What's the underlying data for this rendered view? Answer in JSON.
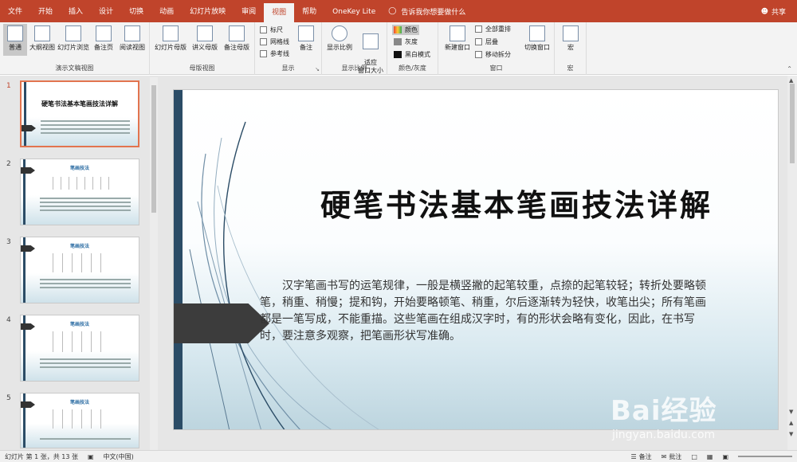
{
  "tabs": [
    "文件",
    "开始",
    "插入",
    "设计",
    "切换",
    "动画",
    "幻灯片放映",
    "审阅",
    "视图",
    "帮助",
    "OneKey Lite"
  ],
  "active_tab": "视图",
  "tellme": "告诉我你想要做什么",
  "share": "共享",
  "ribbon": {
    "presentation_views": {
      "title": "演示文稿视图",
      "buttons": [
        "普通",
        "大纲视图",
        "幻灯片浏览",
        "备注页",
        "阅读视图"
      ]
    },
    "master_views": {
      "title": "母版视图",
      "buttons": [
        "幻灯片母版",
        "讲义母版",
        "备注母版"
      ]
    },
    "show": {
      "title": "显示",
      "checks": [
        "标尺",
        "网格线",
        "参考线"
      ],
      "notes": "备注"
    },
    "zoom": {
      "title": "显示比例",
      "buttons": [
        "显示比例",
        "适应\n窗口大小"
      ]
    },
    "color": {
      "title": "颜色/灰度",
      "options": [
        "颜色",
        "灰度",
        "黑白模式"
      ]
    },
    "window": {
      "title": "窗口",
      "new_window": "新建窗口",
      "items": [
        "全部重排",
        "层叠",
        "移动拆分"
      ],
      "switch": "切换窗口"
    },
    "macros": {
      "title": "宏",
      "button": "宏"
    }
  },
  "thumbnails": [
    {
      "num": "1",
      "title": "硬笔书法基本笔画技法详解",
      "selected": true
    },
    {
      "num": "2",
      "title": "笔画技法",
      "selected": false
    },
    {
      "num": "3",
      "title": "笔画技法",
      "selected": false
    },
    {
      "num": "4",
      "title": "笔画技法",
      "selected": false
    },
    {
      "num": "5",
      "title": "笔画技法",
      "selected": false
    }
  ],
  "slide": {
    "title": "硬笔书法基本笔画技法详解",
    "body": "汉字笔画书写的运笔规律，一般是横竖撇的起笔较重，点捺的起笔较轻；转折处要略顿笔，稍重、稍慢；提和钩，开始要略顿笔、稍重，尔后逐渐转为轻快，收笔出尖；所有笔画都是一笔写成，不能重描。这些笔画在组成汉字时，有的形状会略有变化，因此，在书写时，要注意多观察，把笔画形状写准确。"
  },
  "status": {
    "slide_info": "幻灯片 第 1 张，共 13 张",
    "language": "中文(中国)",
    "notes": "备注",
    "comments": "批注"
  },
  "watermark": {
    "brand": "Bai经验",
    "url": "jingyan.baidu.com"
  },
  "colors": {
    "accent": "#c0442b",
    "slide_bar": "#2b4c66",
    "selected_thumb": "#e2744f"
  }
}
